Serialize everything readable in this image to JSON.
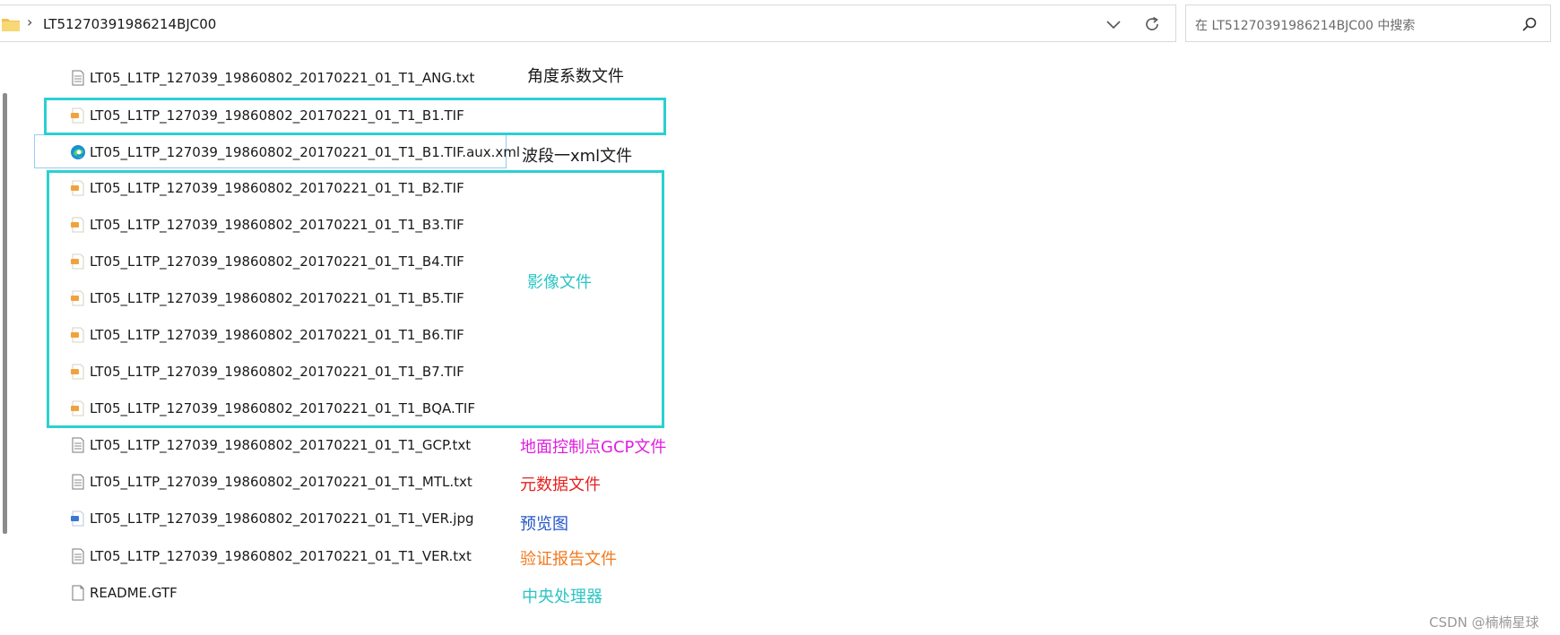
{
  "address_bar": {
    "breadcrumb_separator": "›",
    "current_folder": "LT51270391986214BJC00"
  },
  "search": {
    "placeholder": "在 LT51270391986214BJC00 中搜索"
  },
  "files": [
    {
      "name": "LT05_L1TP_127039_19860802_20170221_01_T1_ANG.txt",
      "icon": "text-file-icon"
    },
    {
      "name": "LT05_L1TP_127039_19860802_20170221_01_T1_B1.TIF",
      "icon": "image-file-icon"
    },
    {
      "name": "LT05_L1TP_127039_19860802_20170221_01_T1_B1.TIF.aux.xml",
      "icon": "edge-browser-icon"
    },
    {
      "name": "LT05_L1TP_127039_19860802_20170221_01_T1_B2.TIF",
      "icon": "image-file-icon"
    },
    {
      "name": "LT05_L1TP_127039_19860802_20170221_01_T1_B3.TIF",
      "icon": "image-file-icon"
    },
    {
      "name": "LT05_L1TP_127039_19860802_20170221_01_T1_B4.TIF",
      "icon": "image-file-icon"
    },
    {
      "name": "LT05_L1TP_127039_19860802_20170221_01_T1_B5.TIF",
      "icon": "image-file-icon"
    },
    {
      "name": "LT05_L1TP_127039_19860802_20170221_01_T1_B6.TIF",
      "icon": "image-file-icon"
    },
    {
      "name": "LT05_L1TP_127039_19860802_20170221_01_T1_B7.TIF",
      "icon": "image-file-icon"
    },
    {
      "name": "LT05_L1TP_127039_19860802_20170221_01_T1_BQA.TIF",
      "icon": "image-file-icon"
    },
    {
      "name": "LT05_L1TP_127039_19860802_20170221_01_T1_GCP.txt",
      "icon": "text-file-icon"
    },
    {
      "name": "LT05_L1TP_127039_19860802_20170221_01_T1_MTL.txt",
      "icon": "text-file-icon"
    },
    {
      "name": "LT05_L1TP_127039_19860802_20170221_01_T1_VER.jpg",
      "icon": "jpg-file-icon"
    },
    {
      "name": "LT05_L1TP_127039_19860802_20170221_01_T1_VER.txt",
      "icon": "text-file-icon"
    },
    {
      "name": "README.GTF",
      "icon": "blank-file-icon"
    }
  ],
  "annotations": [
    {
      "text": "角度系数文件",
      "color": "#1a1a1a"
    },
    {
      "text": "波段一xml文件",
      "color": "#1a1a1a"
    },
    {
      "text": "影像文件",
      "color": "#2bc4c4"
    },
    {
      "text": "地面控制点GCP文件",
      "color": "#e01ee0"
    },
    {
      "text": "元数据文件",
      "color": "#e62020"
    },
    {
      "text": "预览图",
      "color": "#2455c9"
    },
    {
      "text": "验证报告文件",
      "color": "#f07a1e"
    },
    {
      "text": "中央处理器",
      "color": "#2bc4c4"
    }
  ],
  "highlight_color": "#2bd0d0",
  "watermark": "CSDN @楠楠星球"
}
